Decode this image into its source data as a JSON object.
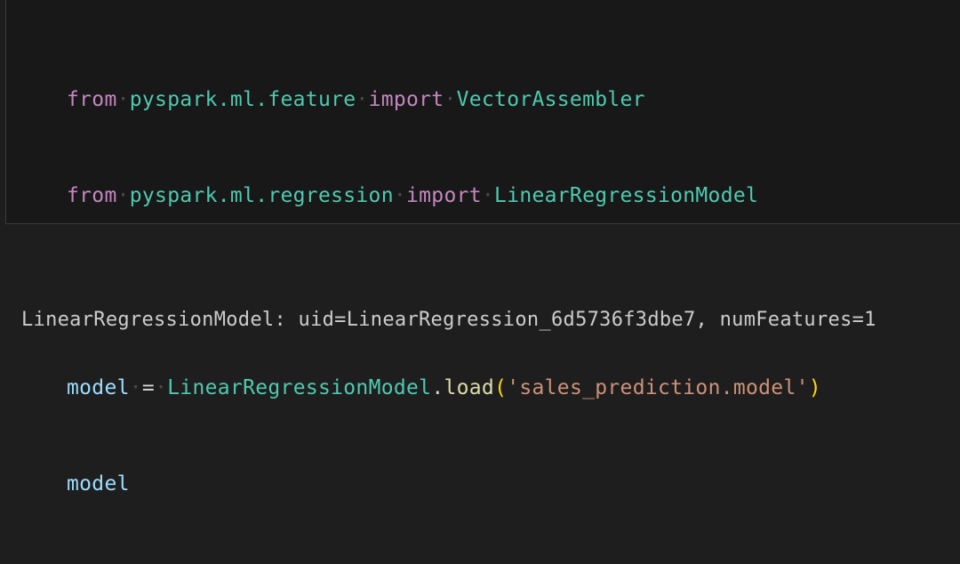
{
  "input_cell": {
    "line1": {
      "kw_from": "from",
      "module": "pyspark.ml.feature",
      "kw_import": "import",
      "name": "VectorAssembler"
    },
    "line2": {
      "kw_from": "from",
      "module": "pyspark.ml.regression",
      "kw_import": "import",
      "name": "LinearRegressionModel"
    },
    "line4": {
      "var": "model",
      "op": "=",
      "class": "LinearRegressionModel",
      "dot": ".",
      "method": "load",
      "paren_open": "(",
      "string": "'sales_prediction.model'",
      "paren_close": ")"
    },
    "line5": {
      "var": "model"
    }
  },
  "output_cell": {
    "text": "LinearRegressionModel: uid=LinearRegression_6d5736f3dbe7, numFeatures=1"
  },
  "colors": {
    "keyword": "#c586c0",
    "module": "#4ec9b0",
    "variable": "#9cdcfe",
    "function": "#dcdcaa",
    "string": "#ce9178",
    "background": "#1e1e1e"
  }
}
